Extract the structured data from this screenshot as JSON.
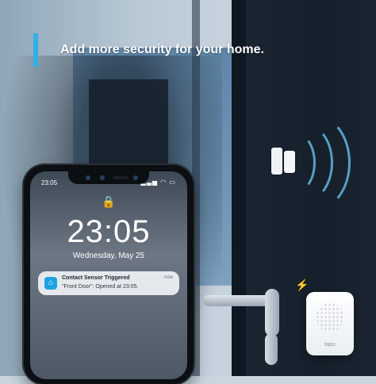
{
  "headline": "Add more security for your home.",
  "phone": {
    "status_time": "23:05",
    "status_icons": "▂▃▅ ◠ ▭",
    "clock": "23:05",
    "date": "Wednesday, May 25",
    "notification": {
      "title": "Contact Sensor Triggered",
      "body": "\"Front Door\": Opened at 23:05.",
      "time": "now",
      "icon": "tapo-app-icon"
    }
  },
  "hub": {
    "logo": "tapo"
  },
  "colors": {
    "accent": "#30b0e6",
    "sensor_wave": "#5fb7e5",
    "notification_icon": "#1aa3e0"
  },
  "icons": {
    "lock": "lock-icon",
    "alert": "alert-bolt-icon",
    "sensor_wave": "signal-wave-icon"
  }
}
